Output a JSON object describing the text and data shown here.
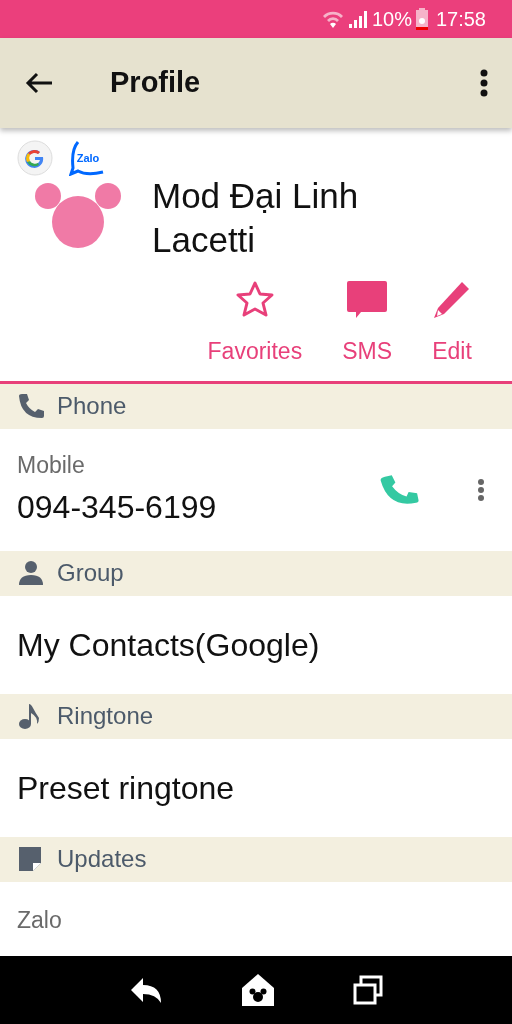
{
  "status_bar": {
    "battery": "10%",
    "time": "17:58"
  },
  "toolbar": {
    "title": "Profile"
  },
  "accounts": [
    {
      "kind": "google"
    },
    {
      "kind": "zalo",
      "label": "Zalo"
    }
  ],
  "contact": {
    "name": "Mod Đại Linh Lacetti"
  },
  "actions": [
    {
      "kind": "favorite",
      "label": "Favorites"
    },
    {
      "kind": "sms",
      "label": "SMS"
    },
    {
      "kind": "edit",
      "label": "Edit"
    }
  ],
  "sections": [
    {
      "kind": "phone",
      "title": "Phone",
      "entries": [
        {
          "label": "Mobile",
          "value": "094-345-6199"
        }
      ]
    },
    {
      "kind": "group",
      "title": "Group",
      "entries": [
        {
          "value": "My Contacts(Google)"
        }
      ]
    },
    {
      "kind": "ringtone",
      "title": "Ringtone",
      "entries": [
        {
          "value": "Preset ringtone"
        }
      ]
    },
    {
      "kind": "updates",
      "title": "Updates",
      "entries": [
        {
          "label": "Zalo"
        }
      ]
    }
  ]
}
